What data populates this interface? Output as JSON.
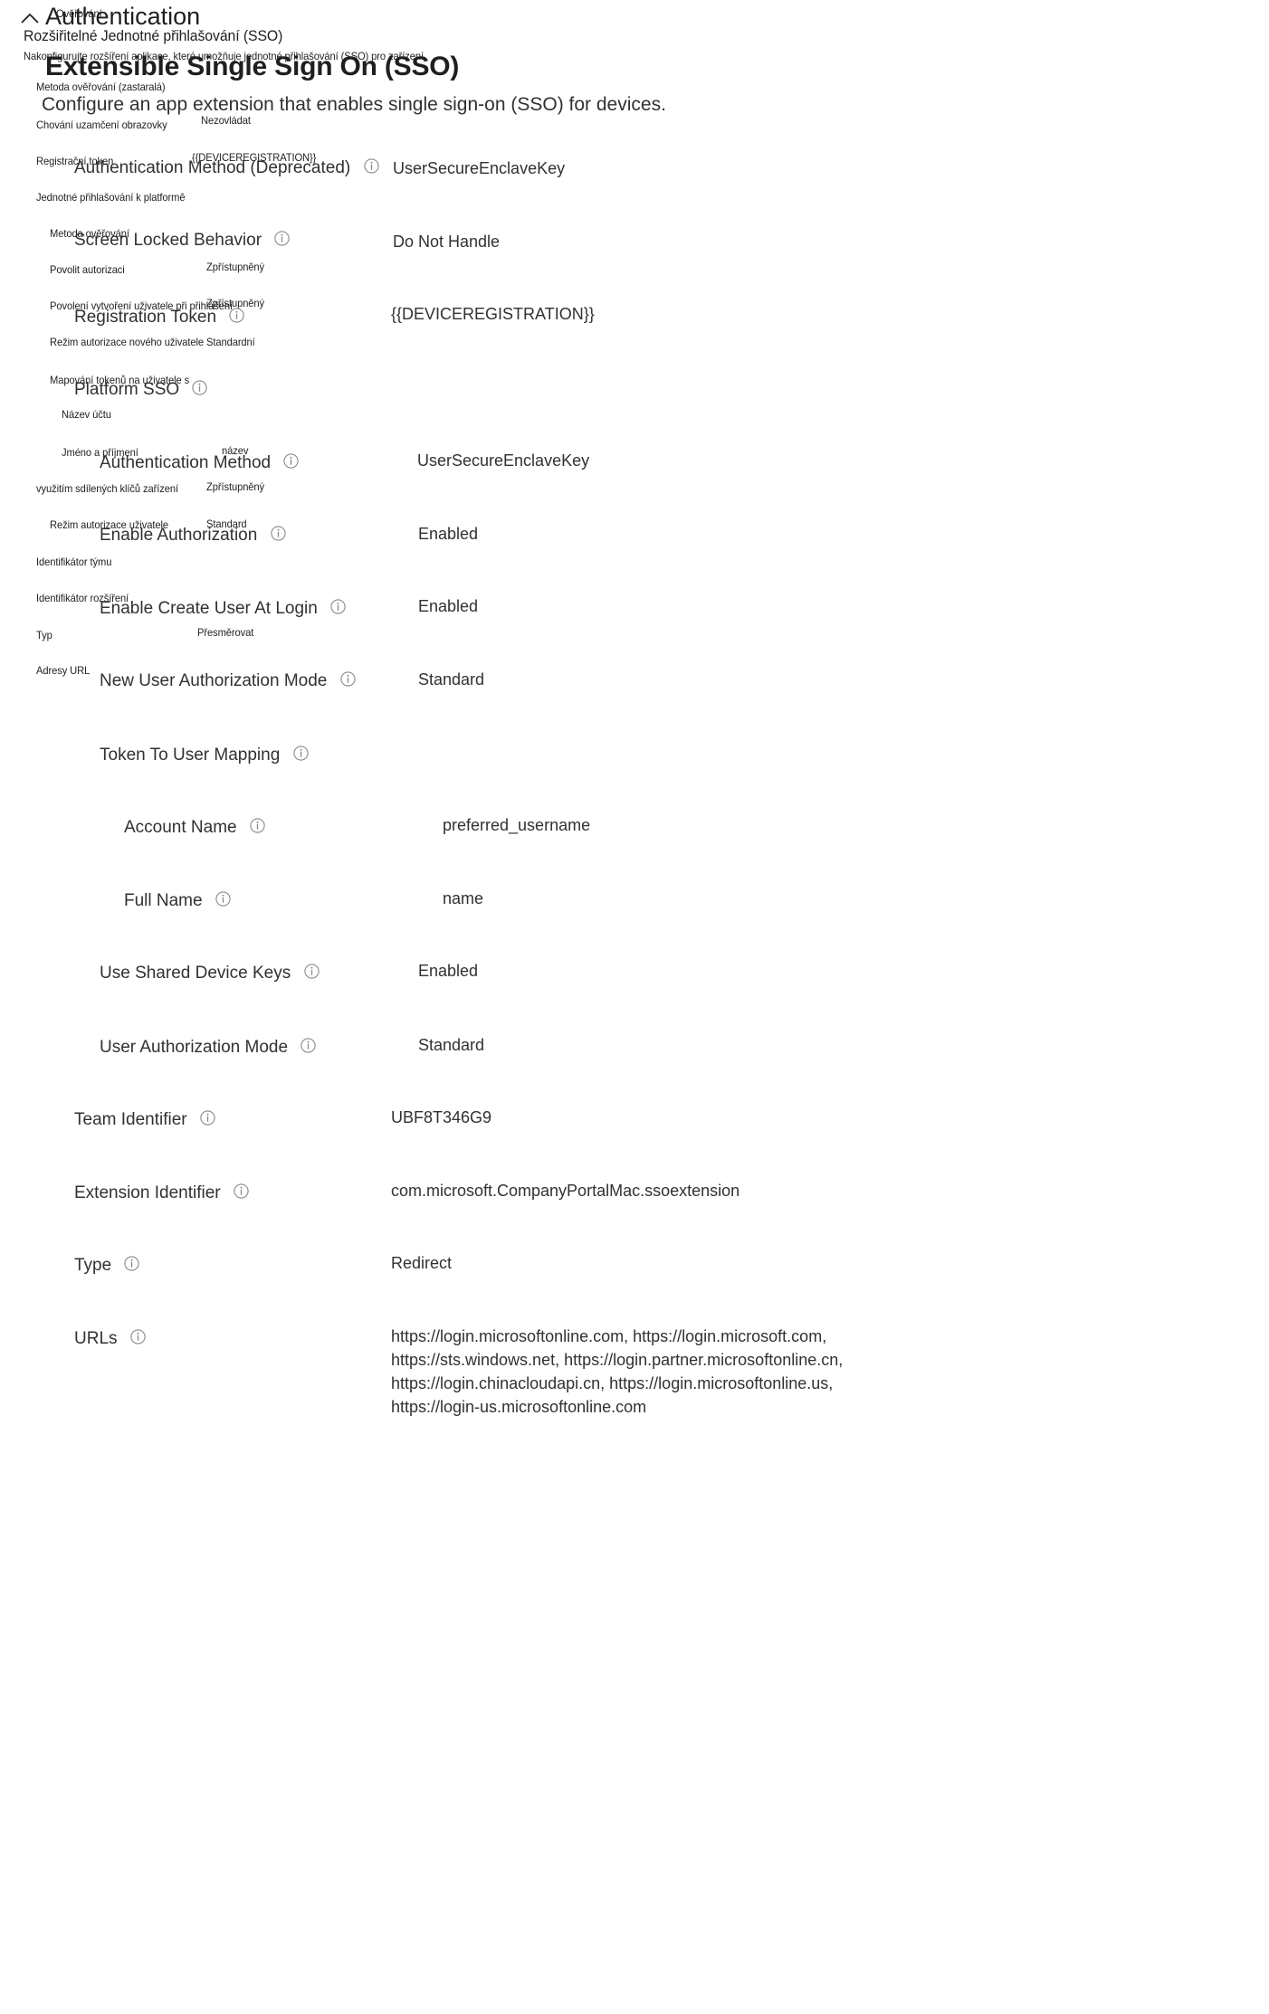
{
  "header": {
    "collapse_icon": "chevron-up-icon",
    "cz_section": "Ověřování",
    "en_section": "Authentication",
    "cz_subsection": "Rozšiřitelné Jednotné přihlašování (SSO)",
    "cz_description": "Nakonfigurujte rozšíření aplikace, které umožňuje jednotné přihlašování (SSO) pro zařízení.",
    "en_title": "Extensible Single Sign On (SSO)",
    "en_description": "Configure an app extension that enables single sign-on (SSO) for devices."
  },
  "info_icon": "info-icon",
  "cz_labels": [
    {
      "label": "Metoda ověřování (zastaralá)"
    },
    {
      "label": "Chování uzamčení obrazovky",
      "value": "Nezovládat"
    },
    {
      "label": "Registrační token",
      "value": "{{DEVICEREGISTRATION}}"
    },
    {
      "label": "Jednotné přihlašování k platformě"
    },
    {
      "label": "Metoda ověřování"
    },
    {
      "label": "Povolit autorizaci",
      "value": "Zpřístupněný"
    },
    {
      "label": "Povolení vytvoření uživatele při přihlášení",
      "value": "Zpřístupněný"
    },
    {
      "label": "Režim autorizace nového uživatele",
      "value": "Standardní"
    },
    {
      "label": "Mapování tokenů na uživatele s"
    },
    {
      "label": "Název účtu"
    },
    {
      "label": "Jméno a příjmení",
      "value": "název"
    },
    {
      "label": "využitím sdílených klíčů zařízení",
      "value": "Zpřístupněný"
    },
    {
      "label": "Režim autorizace uživatele",
      "value": "Standard"
    },
    {
      "label": "Identifikátor týmu"
    },
    {
      "label": "Identifikátor rozšíření"
    },
    {
      "label": "Typ",
      "value": "Přesměrovat"
    },
    {
      "label": "Adresy URL"
    }
  ],
  "settings": [
    {
      "label": "Authentication Method (Deprecated)",
      "value": "UserSecureEnclaveKey"
    },
    {
      "label": "Screen Locked Behavior",
      "value": "Do Not Handle"
    },
    {
      "label": "Registration Token",
      "value": "{{DEVICEREGISTRATION}}"
    },
    {
      "label": "Platform SSO",
      "value": ""
    },
    {
      "label": "Authentication Method",
      "value": "UserSecureEnclaveKey"
    },
    {
      "label": "Enable Authorization",
      "value": "Enabled"
    },
    {
      "label": "Enable Create User At Login",
      "value": "Enabled"
    },
    {
      "label": "New User Authorization Mode",
      "value": "Standard"
    },
    {
      "label": "Token To User Mapping",
      "value": ""
    },
    {
      "label": "Account Name",
      "value": "preferred_username"
    },
    {
      "label": "Full Name",
      "value": "name"
    },
    {
      "label": "Use Shared Device Keys",
      "value": "Enabled"
    },
    {
      "label": "User Authorization Mode",
      "value": "Standard"
    },
    {
      "label": "Team Identifier",
      "value": "UBF8T346G9"
    },
    {
      "label": "Extension Identifier",
      "value": "com.microsoft.CompanyPortalMac.ssoextension"
    },
    {
      "label": "Type",
      "value": "Redirect"
    },
    {
      "label": "URLs",
      "value": "https://login.microsoftonline.com, https://login.microsoft.com, https://sts.windows.net, https://login.partner.microsoftonline.cn, https://login.chinacloudapi.cn, https://login.microsoftonline.us, https://login-us.microsoftonline.com"
    }
  ]
}
